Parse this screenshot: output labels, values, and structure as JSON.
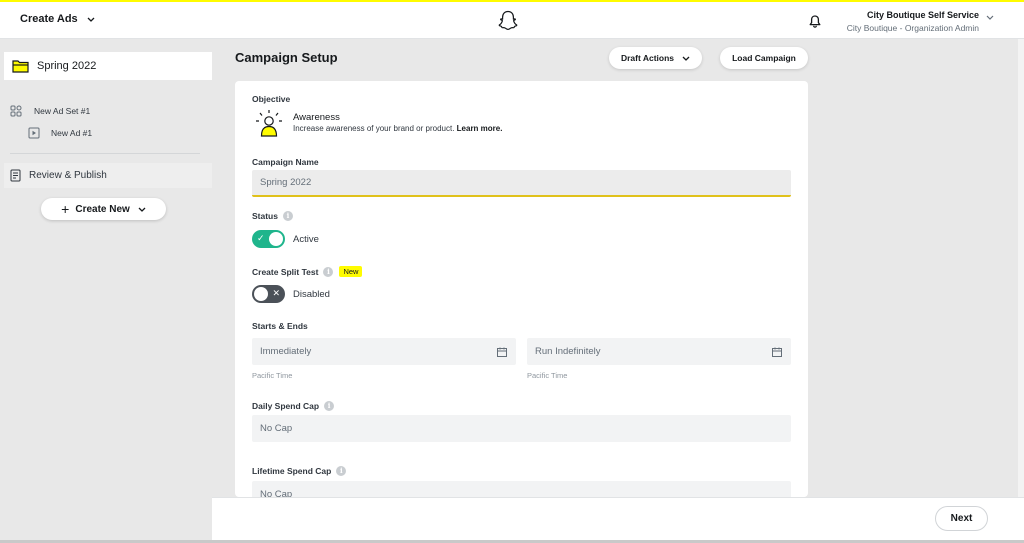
{
  "topbar": {
    "app_menu_label": "Create Ads",
    "account_name": "City Boutique Self Service",
    "account_role": "City Boutique - Organization Admin"
  },
  "sidebar": {
    "campaign_name": "Spring 2022",
    "ad_set_label": "New Ad Set #1",
    "ad_label": "New Ad #1",
    "review_label": "Review & Publish",
    "create_new_label": "Create New"
  },
  "main": {
    "title": "Campaign Setup",
    "draft_actions_label": "Draft Actions",
    "load_campaign_label": "Load Campaign",
    "objective": {
      "label": "Objective",
      "title": "Awareness",
      "description": "Increase awareness of your brand or product.",
      "learn_more": "Learn more."
    },
    "campaign_name": {
      "label": "Campaign Name",
      "value": "Spring 2022"
    },
    "status": {
      "label": "Status",
      "value": "Active",
      "enabled": true
    },
    "split_test": {
      "label": "Create Split Test",
      "badge": "New",
      "value": "Disabled",
      "enabled": false
    },
    "schedule": {
      "label": "Starts & Ends",
      "start_value": "Immediately",
      "end_value": "Run Indefinitely",
      "start_hint": "Pacific Time",
      "end_hint": "Pacific Time"
    },
    "daily_spend": {
      "label": "Daily Spend Cap",
      "value": "No Cap"
    },
    "lifetime_spend": {
      "label": "Lifetime Spend Cap",
      "value": "No Cap"
    }
  },
  "footer": {
    "next_label": "Next"
  },
  "colors": {
    "brand_yellow": "#fffc00",
    "toggle_on": "#1fb58c",
    "toggle_off": "#4b5158"
  }
}
